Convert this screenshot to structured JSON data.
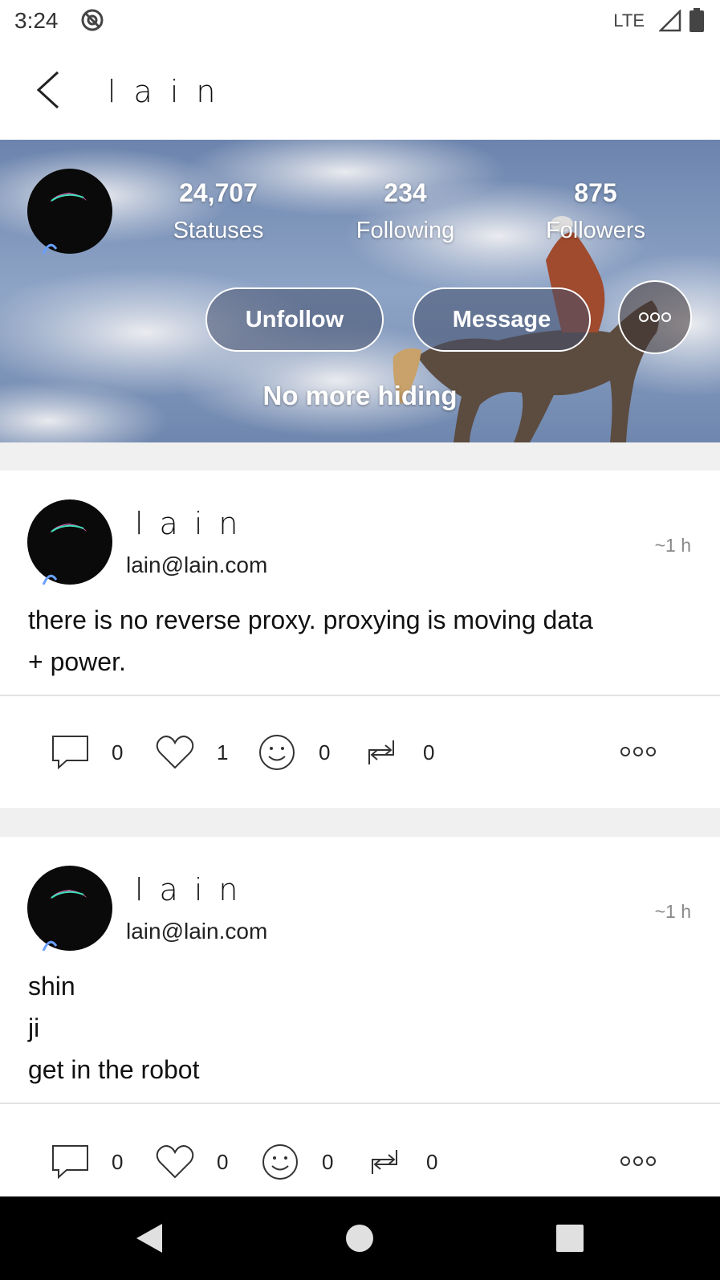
{
  "status_bar": {
    "time": "3:24",
    "network": "LTE"
  },
  "app_bar": {
    "title": "lain"
  },
  "profile": {
    "stats": [
      {
        "value": "24,707",
        "label": "Statuses"
      },
      {
        "value": "234",
        "label": "Following"
      },
      {
        "value": "875",
        "label": "Followers"
      }
    ],
    "buttons": {
      "unfollow": "Unfollow",
      "message": "Message"
    },
    "bio": "No more hiding"
  },
  "posts": [
    {
      "name": "lain",
      "handle": "lain@lain.com",
      "time": "~1 h",
      "lines": [
        "there is no reverse proxy. proxying is moving data",
        "+ power."
      ],
      "counts": {
        "replies": "0",
        "likes": "1",
        "reactions": "0",
        "boosts": "0"
      }
    },
    {
      "name": "lain",
      "handle": "lain@lain.com",
      "time": "~1 h",
      "lines": [
        "shin",
        "ji",
        "get in the robot"
      ],
      "counts": {
        "replies": "0",
        "likes": "0",
        "reactions": "0",
        "boosts": "0"
      }
    }
  ],
  "icons": [
    "dnd-icon",
    "signal-icon",
    "battery-icon",
    "back-icon",
    "avatar",
    "more-icon",
    "reply-icon",
    "like-icon",
    "reaction-icon",
    "boost-icon",
    "nav-back-icon",
    "nav-home-icon",
    "nav-recents-icon"
  ]
}
